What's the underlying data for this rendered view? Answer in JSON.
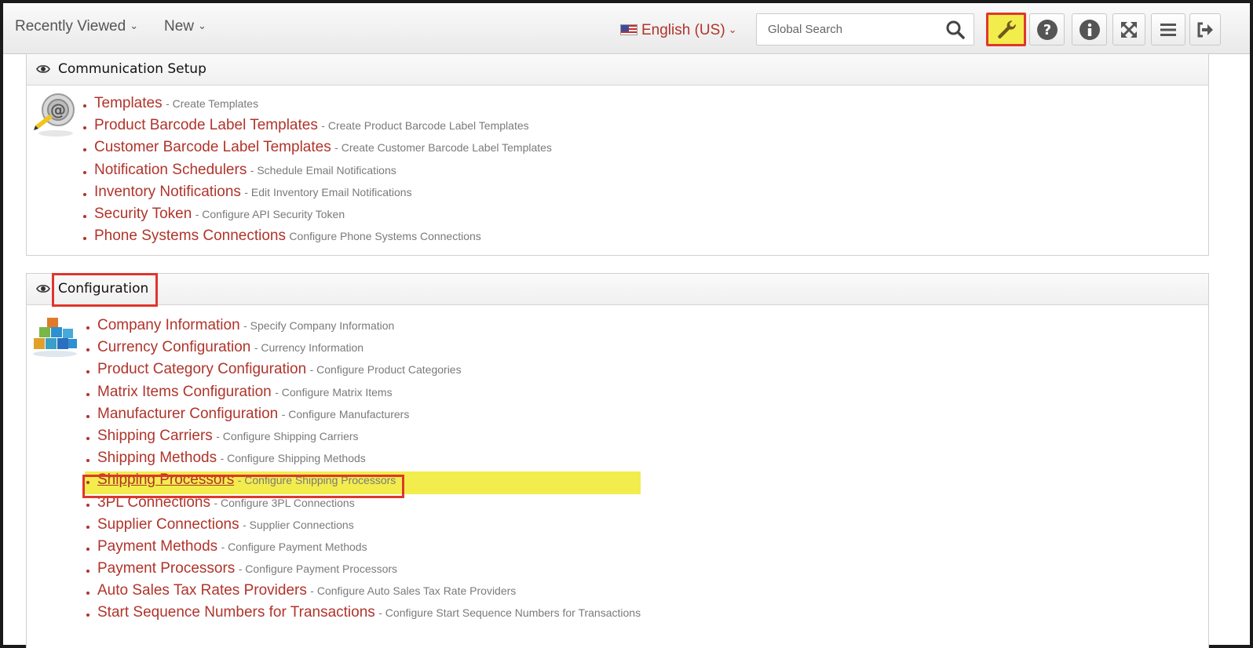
{
  "topbar": {
    "recently_viewed": "Recently Viewed",
    "new": "New",
    "language": "English (US)",
    "search_placeholder": "Global Search"
  },
  "colors": {
    "link": "#b0342b",
    "highlight": "#f2ed4d",
    "callout_border": "#e0362c"
  },
  "icons": [
    "search-icon",
    "wrench-icon",
    "help-icon",
    "info-icon",
    "fullscreen-icon",
    "menu-icon",
    "logout-icon",
    "eye-icon",
    "flag-us-icon"
  ],
  "communication": {
    "title": "Communication Setup",
    "items": [
      {
        "label": "Templates",
        "desc": "- Create Templates"
      },
      {
        "label": "Product Barcode Label Templates",
        "desc": "- Create Product Barcode Label Templates"
      },
      {
        "label": "Customer Barcode Label Templates",
        "desc": "- Create Customer Barcode Label Templates"
      },
      {
        "label": "Notification Schedulers",
        "desc": "- Schedule Email Notifications"
      },
      {
        "label": "Inventory Notifications",
        "desc": "- Edit Inventory Email Notifications"
      },
      {
        "label": "Security Token",
        "desc": "- Configure API Security Token"
      },
      {
        "label": "Phone Systems Connections",
        "desc": "Configure Phone Systems Connections"
      }
    ]
  },
  "configuration": {
    "title": "Configuration",
    "items": [
      {
        "label": "Company Information",
        "desc": "- Specify Company Information"
      },
      {
        "label": "Currency Configuration",
        "desc": "- Currency Information"
      },
      {
        "label": "Product Category Configuration",
        "desc": "- Configure Product Categories"
      },
      {
        "label": "Matrix Items Configuration",
        "desc": "- Configure Matrix Items"
      },
      {
        "label": "Manufacturer Configuration",
        "desc": "- Configure Manufacturers"
      },
      {
        "label": "Shipping Carriers",
        "desc": "- Configure Shipping Carriers"
      },
      {
        "label": "Shipping Methods",
        "desc": "- Configure Shipping Methods"
      },
      {
        "label": "Shipping Processors",
        "desc": "- Configure Shipping Processors"
      },
      {
        "label": "3PL Connections",
        "desc": "- Configure 3PL Connections"
      },
      {
        "label": "Supplier Connections",
        "desc": "- Supplier Connections"
      },
      {
        "label": "Payment Methods",
        "desc": "- Configure Payment Methods"
      },
      {
        "label": "Payment Processors",
        "desc": "- Configure Payment Processors"
      },
      {
        "label": "Auto Sales Tax Rates Providers",
        "desc": "- Configure Auto Sales Tax Rate Providers"
      },
      {
        "label": "Start Sequence Numbers for Transactions",
        "desc": "- Configure Start Sequence Numbers for Transactions"
      }
    ]
  }
}
